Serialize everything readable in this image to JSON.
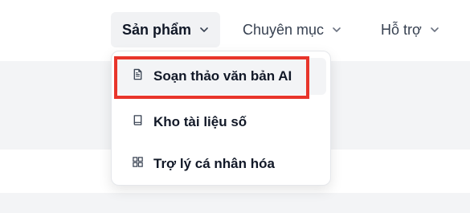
{
  "nav": {
    "items": [
      {
        "label": "Sản phẩm",
        "icon": "chevron-down-icon",
        "active": true
      },
      {
        "label": "Chuyên mục",
        "icon": "chevron-down-icon",
        "active": false
      },
      {
        "label": "Hỗ trợ",
        "icon": "chevron-down-icon",
        "active": false
      }
    ]
  },
  "dropdown": {
    "items": [
      {
        "label": "Soạn thảo văn bản AI",
        "icon": "document-icon",
        "highlighted": true
      },
      {
        "label": "Kho tài liệu số",
        "icon": "book-icon",
        "highlighted": false
      },
      {
        "label": "Trợ lý cá nhân hóa",
        "icon": "grid-icon",
        "highlighted": false
      }
    ]
  },
  "colors": {
    "highlight_border": "#e8352b",
    "active_bg": "#f1f2f4",
    "band_grey": "#f3f4f6"
  }
}
